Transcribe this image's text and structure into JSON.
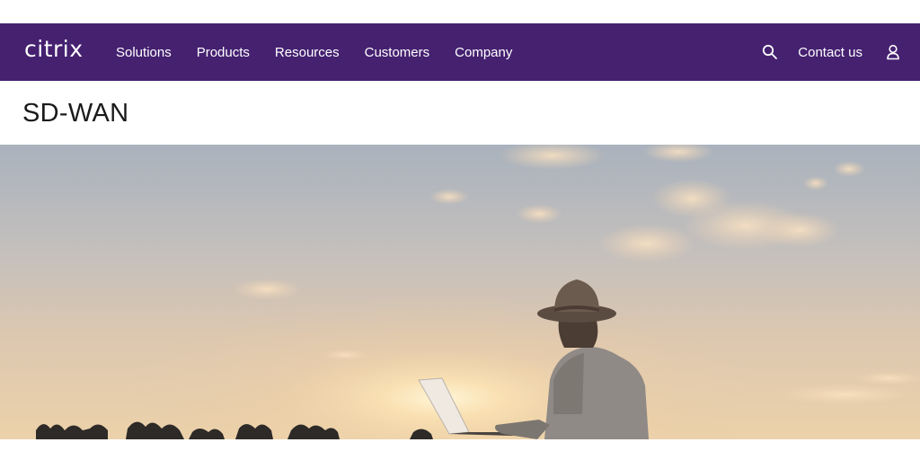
{
  "colors": {
    "nav_bg": "#452170",
    "nav_text": "#ffffff",
    "title_text": "#1a1a1a"
  },
  "header": {
    "logo": "citrix",
    "nav": [
      {
        "label": "Solutions"
      },
      {
        "label": "Products"
      },
      {
        "label": "Resources"
      },
      {
        "label": "Customers"
      },
      {
        "label": "Company"
      }
    ],
    "search_icon": "search-icon",
    "contact_label": "Contact us",
    "account_icon": "user-icon"
  },
  "page": {
    "title": "SD-WAN"
  },
  "hero": {
    "image": "sunset-field-person-with-laptop"
  }
}
